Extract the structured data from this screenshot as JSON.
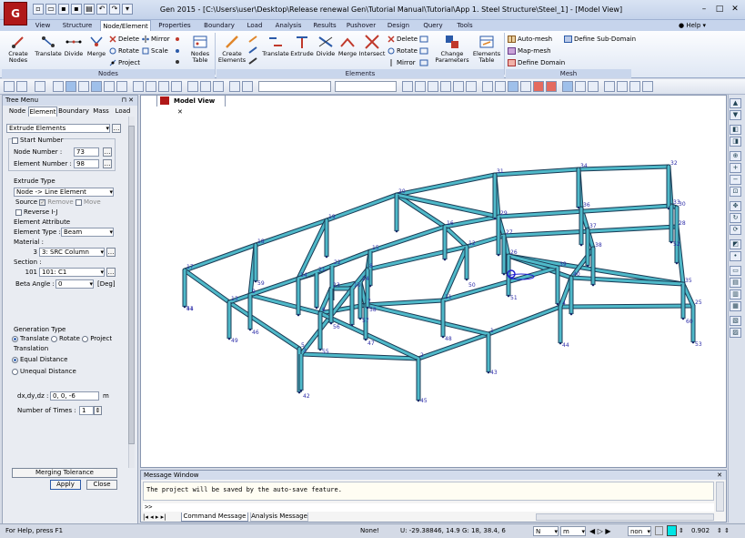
{
  "title": "Gen 2015 - [C:\\Users\\user\\Desktop\\Release renewal Gen\\Tutorial Manual\\Tutorial\\App 1. Steel Structure\\Steel_1] - [Model View]",
  "logo_text": "G",
  "ribbon_tabs": [
    "View",
    "Structure",
    "Node/Element",
    "Properties",
    "Boundary",
    "Load",
    "Analysis",
    "Results",
    "Pushover",
    "Design",
    "Query",
    "Tools"
  ],
  "help_label": "Help",
  "ribbon": {
    "nodes": {
      "label": "Nodes",
      "create": "Create Nodes",
      "translate": "Translate",
      "divide": "Divide",
      "merge": "Merge",
      "delete": "Delete",
      "rotate": "Rotate",
      "project": "Project",
      "mirror": "Mirror",
      "scale": "Scale",
      "table": "Nodes Table"
    },
    "elements": {
      "label": "Elements",
      "create": "Create Elements",
      "translate": "Translate",
      "extrude": "Extrude",
      "divide": "Divide",
      "merge": "Merge",
      "intersect": "Intersect",
      "delete": "Delete",
      "rotate": "Rotate",
      "mirror": "Mirror",
      "change": "Change Parameters",
      "table": "Elements Table"
    },
    "mesh": {
      "label": "Mesh",
      "auto": "Auto-mesh",
      "map": "Map-mesh",
      "define_domain": "Define Domain",
      "define_sub": "Define Sub-Domain"
    }
  },
  "tree_menu": {
    "title": "Tree Menu",
    "tabs": [
      "Node",
      "Element",
      "Boundary",
      "Mass",
      "Load"
    ],
    "command": "Extrude Elements",
    "start_number": "Start Number",
    "node_number_label": "Node Number",
    "node_number": "73",
    "element_number_label": "Element Number",
    "element_number": "98",
    "extrude_type_label": "Extrude Type",
    "extrude_type": "Node -> Line Element",
    "source_label": "Source",
    "remove": "Remove",
    "move": "Move",
    "reverse": "Reverse I-J",
    "element_attribute": "Element Attribute",
    "element_type_label": "Element Type",
    "element_type": "Beam",
    "material_label": "Material :",
    "material_no": "3",
    "material": "3: SRC Column",
    "section_label": "Section :",
    "section_no": "101",
    "section": "101: C1",
    "beta_label": "Beta Angle :",
    "beta_value": "0",
    "beta_unit": "[Deg]",
    "generation_type": "Generation Type",
    "gen_translate": "Translate",
    "gen_rotate": "Rotate",
    "gen_project": "Project",
    "translation": "Translation",
    "equal_distance": "Equal Distance",
    "unequal_distance": "Unequal Distance",
    "dxdydz_label": "dx,dy,dz :",
    "dxdydz": "0, 0, -6",
    "dxdydz_unit": "m",
    "times_label": "Number of Times :",
    "times": "1",
    "merging_tolerance": "Merging Tolerance",
    "apply": "Apply",
    "close": "Close"
  },
  "doc_tab": "Model View",
  "message_window": {
    "title": "Message Window",
    "text": "The project will be saved by the auto-save feature.",
    "prompt": ">>",
    "tabs": [
      "Command Message",
      "Analysis Message"
    ]
  },
  "status": {
    "help": "For Help, press F1",
    "none": "None!",
    "coords_u": "U: -29.38846, 14.9023, 0",
    "coords_g": "G: 18, 38.4, 6",
    "unit_force": "N",
    "unit_length": "m",
    "combo": "non",
    "number": "0.902"
  },
  "node_labels": [
    "1",
    "2",
    "3",
    "4",
    "5",
    "6",
    "7",
    "8",
    "9",
    "10",
    "11",
    "12",
    "13",
    "14",
    "15",
    "16",
    "17",
    "18",
    "19",
    "20",
    "21",
    "22",
    "23",
    "24",
    "25",
    "26",
    "27",
    "28",
    "29",
    "30",
    "31",
    "32",
    "33",
    "34",
    "35",
    "36",
    "37",
    "38",
    "39",
    "40",
    "41",
    "42",
    "43",
    "44",
    "45",
    "46",
    "47",
    "48",
    "49",
    "50",
    "51",
    "52",
    "53",
    "54",
    "55",
    "56",
    "57",
    "58",
    "59",
    "60"
  ],
  "colors": {
    "beam": "#4fb9c9",
    "edge": "#1b3b55",
    "accent": "#2b5aa8"
  }
}
